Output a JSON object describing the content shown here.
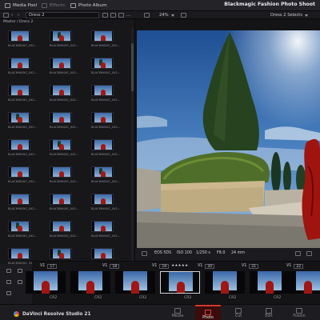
{
  "toolbar": {
    "items": [
      {
        "label": "Media Pool",
        "icon": "media-pool-icon",
        "active": true
      },
      {
        "label": "Effects",
        "icon": "effects-icon",
        "active": false
      },
      {
        "label": "Photo Album",
        "icon": "photo-album-icon",
        "active": true
      }
    ],
    "title": "Blackmagic Fashion Photo Shoot"
  },
  "subbar": {
    "album_dropdown": "Dress 2",
    "zoom": "24%",
    "selection_dropdown": "Dress 2 Selects"
  },
  "browser": {
    "breadcrumb": "Master / Dress 2",
    "thumb_caption": "BLACKMAGIC_042...",
    "rows": 10,
    "cols": 3
  },
  "viewer": {
    "meta": {
      "camera": "EOS 5DS",
      "iso": "ISO 100",
      "shutter": "1/250 s",
      "aperture": "F8.0",
      "focal": "24 mm"
    }
  },
  "filmstrip": {
    "labels": [
      {
        "track": "V1",
        "num": "17"
      },
      {
        "track": "V1",
        "num": "18"
      },
      {
        "track": "V1",
        "num": "19",
        "stars": "★★★★★"
      },
      {
        "track": "V1",
        "num": "20"
      },
      {
        "track": "V1",
        "num": "21"
      },
      {
        "track": "V1",
        "num": "22"
      }
    ],
    "caption": "CR2",
    "selected_index": 3
  },
  "pagebar": {
    "brand": "DaVinci Resolve Studio 21",
    "pages": [
      {
        "label": "Media",
        "icon": "media-page-icon"
      },
      {
        "label": "Photo",
        "icon": "photo-page-icon",
        "active": true
      },
      {
        "label": "Cut",
        "icon": "cut-page-icon"
      },
      {
        "label": "Edit",
        "icon": "edit-page-icon"
      },
      {
        "label": "Fusion",
        "icon": "fusion-page-icon"
      }
    ]
  },
  "colors": {
    "accent": "#d6382f",
    "panel": "#17171a",
    "sky": "#2d5fa3"
  }
}
